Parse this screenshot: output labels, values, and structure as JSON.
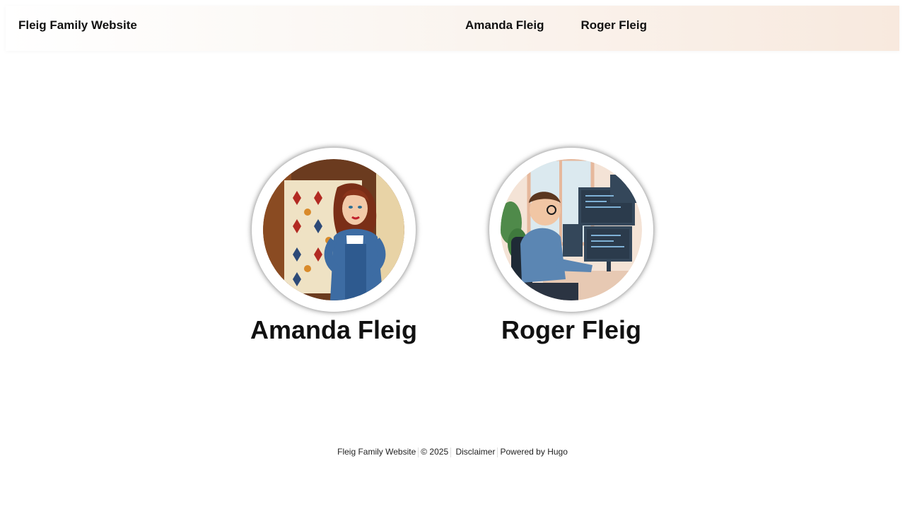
{
  "header": {
    "site_title": "Fleig Family Website",
    "nav": [
      {
        "label": "Amanda Fleig"
      },
      {
        "label": "Roger Fleig"
      }
    ]
  },
  "cards": [
    {
      "name": "Amanda Fleig",
      "image": "amanda-quilting-illustration"
    },
    {
      "name": "Roger Fleig",
      "image": "roger-programming-illustration"
    }
  ],
  "footer": {
    "site_name": "Fleig Family Website",
    "copyright": "© 2025",
    "disclaimer": "Disclaimer",
    "powered_by": "Powered by Hugo"
  }
}
